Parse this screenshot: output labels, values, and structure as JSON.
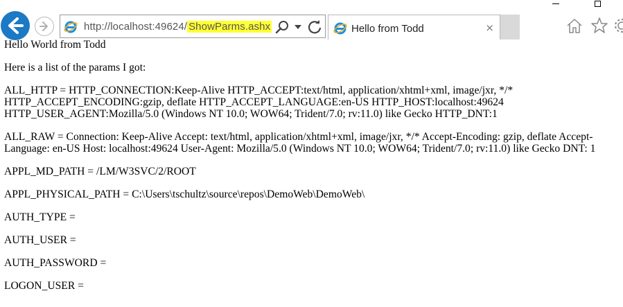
{
  "window": {
    "controls": [
      "minimize",
      "maximize"
    ]
  },
  "toolbar": {
    "address": {
      "url_prefix": "http://localhost:49624/",
      "url_highlight": "ShowParms.ashx",
      "highlight_color": "#ffff33"
    },
    "tab": {
      "title": "Hello from Todd",
      "close_label": "×"
    },
    "accent": "#1c79c4"
  },
  "content": {
    "lines": [
      "Hello World from Todd",
      "Here is a list of the params I got:",
      "ALL_HTTP = HTTP_CONNECTION:Keep-Alive HTTP_ACCEPT:text/html, application/xhtml+xml, image/jxr, */* HTTP_ACCEPT_ENCODING:gzip, deflate HTTP_ACCEPT_LANGUAGE:en-US HTTP_HOST:localhost:49624 HTTP_USER_AGENT:Mozilla/5.0 (Windows NT 10.0; WOW64; Trident/7.0; rv:11.0) like Gecko HTTP_DNT:1",
      "ALL_RAW = Connection: Keep-Alive Accept: text/html, application/xhtml+xml, image/jxr, */* Accept-Encoding: gzip, deflate Accept-Language: en-US Host: localhost:49624 User-Agent: Mozilla/5.0 (Windows NT 10.0; WOW64; Trident/7.0; rv:11.0) like Gecko DNT: 1",
      "APPL_MD_PATH = /LM/W3SVC/2/ROOT",
      "APPL_PHYSICAL_PATH = C:\\Users\\tschultz\\source\\repos\\DemoWeb\\DemoWeb\\",
      "AUTH_TYPE =",
      "AUTH_USER =",
      "AUTH_PASSWORD =",
      "LOGON_USER ="
    ]
  }
}
